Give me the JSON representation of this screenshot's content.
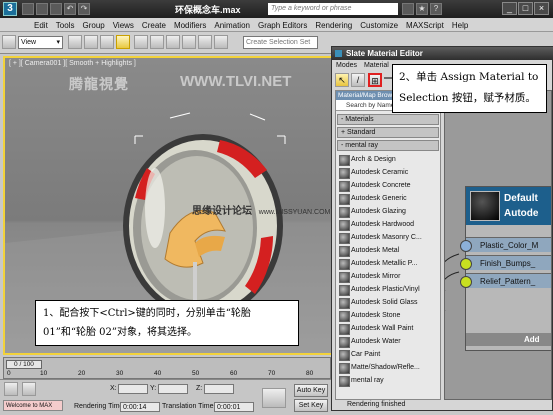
{
  "titlebar": {
    "app_logo": "3",
    "title": "环保概念车.max",
    "search_placeholder": "Type a keyword or phrase",
    "min_label": "_",
    "max_label": "□",
    "close_label": "×"
  },
  "menu": [
    "Edit",
    "Tools",
    "Group",
    "Views",
    "Create",
    "Modifiers",
    "Animation",
    "Graph Editors",
    "Rendering",
    "Customize",
    "MAXScript",
    "Help"
  ],
  "toolbar": {
    "view_value": "View",
    "selection_set_placeholder": "Create Selection Set"
  },
  "viewport": {
    "label": "[ + ][ Camera001 ][ Smooth + Highlights ]",
    "watermark": "腾龍視覺",
    "watermark_url": "WWW.TLVI.NET",
    "forum_watermark": "思缘设计论坛",
    "forum_url": "www.MISSYUAN.COM"
  },
  "callouts": {
    "step1": "1、配合按下<Ctrl>键的同时，分别单击“轮胎 01”和“轮胎 02”对象，将其选择。",
    "step2": "2、单击 Assign Material to Selection 按钮，赋予材质。"
  },
  "slate": {
    "title": "Slate Material Editor",
    "menu": [
      "Modes",
      "Material"
    ],
    "browser_header": "Material/Map Browser",
    "search_placeholder": "Search by Name ...",
    "rollouts": {
      "materials": "- Materials",
      "standard": "+ Standard",
      "mental_ray": "- mental ray"
    },
    "materials": [
      "Arch & Design",
      "Autodesk Ceramic",
      "Autodesk Concrete",
      "Autodesk Generic",
      "Autodesk Glazing",
      "Autodesk Hardwood",
      "Autodesk Masonry C...",
      "Autodesk Metal",
      "Autodesk Metallic P...",
      "Autodesk Mirror",
      "Autodesk Plastic/Vinyl",
      "Autodesk Solid Glass",
      "Autodesk Stone",
      "Autodesk Wall Paint",
      "Autodesk Water",
      "Car Paint",
      "Matte/Shadow/Refle...",
      "mental ray"
    ],
    "node": {
      "name_line1": "Default",
      "name_line2": "Autode",
      "slots": [
        "Plastic_Color_M",
        "Finish_Bumps_",
        "Relief_Pattern_"
      ],
      "add_label": "Add"
    },
    "status": "Rendering finished"
  },
  "timeline": {
    "slider": "0 / 100",
    "ticks": [
      "0",
      "10",
      "20",
      "30",
      "40",
      "50",
      "60",
      "70",
      "80"
    ]
  },
  "statusbar": {
    "welcome": "Welcome to MAX",
    "x_label": "X:",
    "y_label": "Y:",
    "z_label": "Z:",
    "rendering_time_label": "Rendering Time",
    "rendering_time_value": "0:00:14",
    "translation_time_label": "Translation Time",
    "translation_time_value": "0:00:01",
    "auto_key": "Auto Key",
    "set_key": "Set Key"
  },
  "colors": {
    "viewport_border": "#f2d23a",
    "node_header": "#1d5f8c",
    "slot_input_green": "#c8e020",
    "slot_input_blue": "#8cb0d8",
    "tire_red": "#d42020"
  }
}
